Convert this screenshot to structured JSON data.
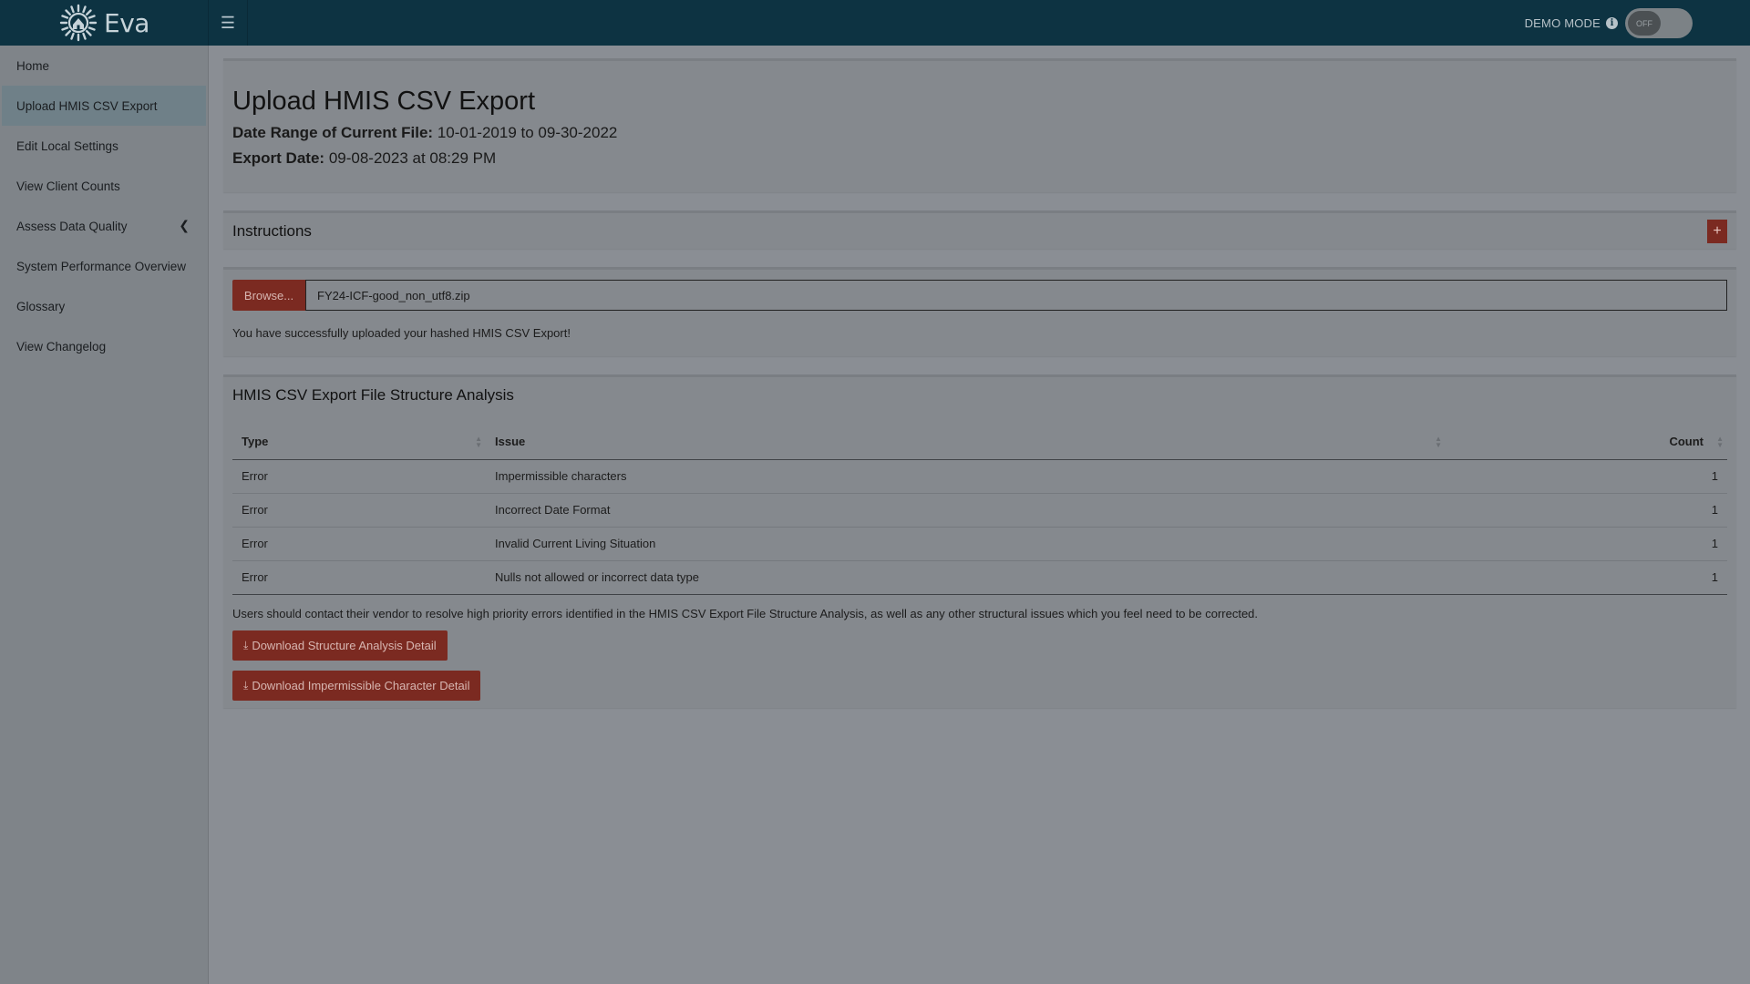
{
  "app": {
    "brand_name": "Eva",
    "menu_toggle_icon": "hamburger-icon",
    "demo_mode_label": "DEMO MODE",
    "demo_mode_state": "OFF"
  },
  "sidebar": {
    "items": [
      {
        "label": "Home",
        "active": false
      },
      {
        "label": "Upload HMIS CSV Export",
        "active": true
      },
      {
        "label": "Edit Local Settings",
        "active": false
      },
      {
        "label": "View Client Counts",
        "active": false
      },
      {
        "label": "Assess Data Quality",
        "active": false,
        "has_submenu": true
      },
      {
        "label": "System Performance Overview",
        "active": false
      },
      {
        "label": "Glossary",
        "active": false
      },
      {
        "label": "View Changelog",
        "active": false
      }
    ]
  },
  "header": {
    "title": "Upload HMIS CSV Export",
    "date_range_label": "Date Range of Current File:",
    "date_range_value": "10-01-2019 to 09-30-2022",
    "export_date_label": "Export Date:",
    "export_date_value": "09-08-2023 at 08:29 PM"
  },
  "instructions": {
    "title": "Instructions",
    "expand_label": "+"
  },
  "upload": {
    "browse_label": "Browse...",
    "file_name": "FY24-ICF-good_non_utf8.zip",
    "success_message": "You have successfully uploaded your hashed HMIS CSV Export!"
  },
  "analysis": {
    "title": "HMIS CSV Export File Structure Analysis",
    "columns": [
      "Type",
      "Issue",
      "Count"
    ],
    "rows": [
      {
        "type": "Error",
        "issue": "Impermissible characters",
        "count": "1"
      },
      {
        "type": "Error",
        "issue": "Incorrect Date Format",
        "count": "1"
      },
      {
        "type": "Error",
        "issue": "Invalid Current Living Situation",
        "count": "1"
      },
      {
        "type": "Error",
        "issue": "Nulls not allowed or incorrect data type",
        "count": "1"
      }
    ],
    "note": "Users should contact their vendor to resolve high priority errors identified in the HMIS CSV Export File Structure Analysis, as well as any other structural issues which you feel need to be corrected.",
    "download_structure_label": "Download Structure Analysis Detail",
    "download_impermissible_label": "Download Impermissible Character Detail"
  },
  "colors": {
    "topbar": "#0d3342",
    "accent": "#7b2a21",
    "sidebar_active": "#6f8088"
  }
}
